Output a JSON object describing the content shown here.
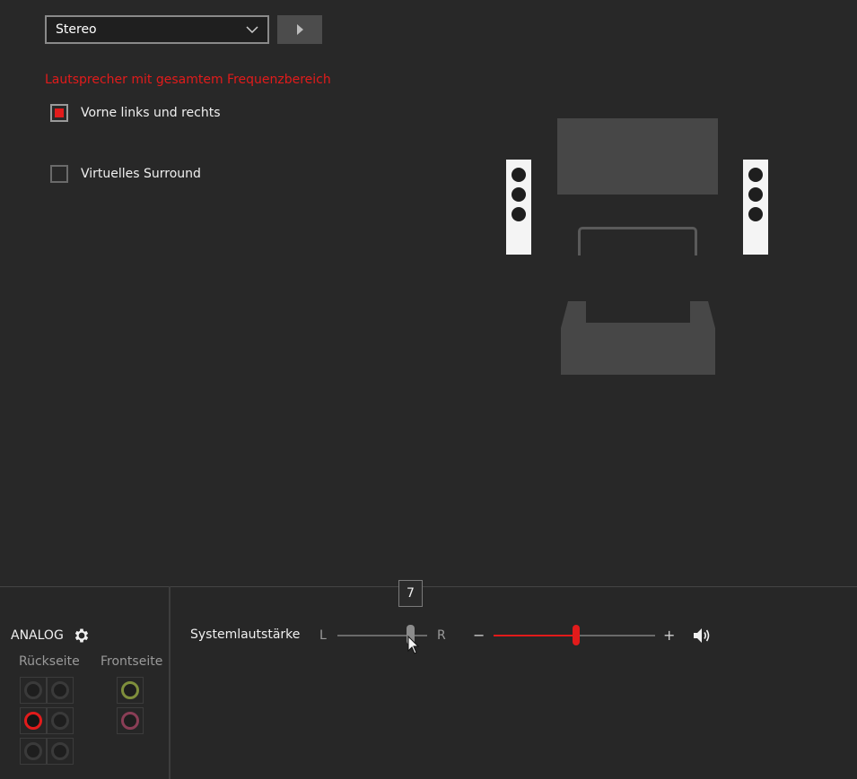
{
  "config": {
    "selected": "Stereo",
    "section_title": "Lautsprecher mit gesamtem Frequenzbereich",
    "options": [
      {
        "label": "Vorne links und rechts",
        "checked": true
      },
      {
        "label": "Virtuelles Surround",
        "checked": false
      }
    ]
  },
  "bottom": {
    "analog_label": "ANALOG",
    "rear_label": "Rückseite",
    "front_label": "Frontseite",
    "system_volume_label": "Systemlautstärke",
    "balance_left": "L",
    "balance_right": "R",
    "balance_tooltip": "7",
    "volume_minus": "−",
    "volume_plus": "+",
    "volume_fraction": 0.51,
    "balance_fraction": 0.82
  },
  "colors": {
    "accent": "#e21b1b",
    "front_jack_1": "#7f8f3c",
    "front_jack_2": "#8a3e56"
  },
  "icons": {
    "dropdown": "chevron-down-icon",
    "play": "play-icon",
    "settings": "gear-icon",
    "volume": "speaker-volume-icon"
  }
}
